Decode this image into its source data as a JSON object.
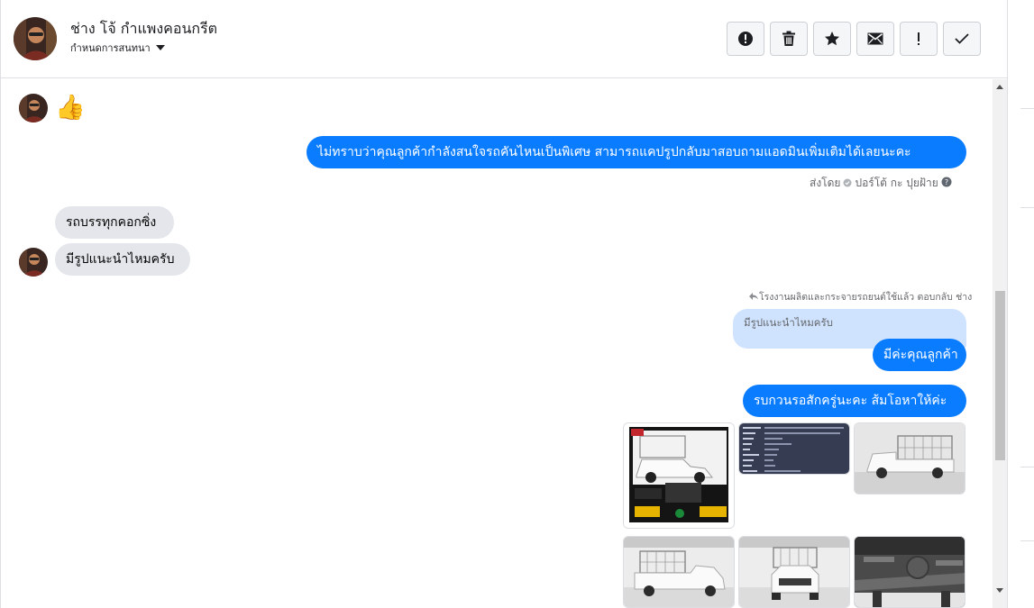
{
  "header": {
    "contact_name": "ช่าง โจ้ กำแพงคอนกรีต",
    "assign_label": "กำหนดการสนทนา",
    "actions": [
      {
        "icon": "alert-circle-icon"
      },
      {
        "icon": "trash-icon"
      },
      {
        "icon": "star-icon"
      },
      {
        "icon": "envelope-icon"
      },
      {
        "icon": "exclamation-icon"
      },
      {
        "icon": "checkmark-icon"
      }
    ]
  },
  "thread": {
    "reaction_emoji": "👍",
    "messages": {
      "outgoing_1": "ไม่ทราบว่าคุณลูกค้ากำลังสนใจรถคันไหนเป็นพิเศษ สามารถแคปรูปกลับมาสอบถามแอดมินเพิ่มเติมได้เลยนะคะ",
      "sent_by_prefix": "ส่งโดย",
      "sent_by_name": "ปอร์โต้ กะ ปุยฝ้าย",
      "incoming_1": "รถบรรทุกคอกซิ่ง",
      "incoming_2": "มีรูปแนะนำไหมครับ",
      "reply_label": "โรงงานผลิตและกระจายรถยนต์ใช้แล้ว ตอบกลับ ช่าง",
      "quoted_text": "มีรูปแนะนำไหมครับ",
      "outgoing_2": "มีค่ะคุณลูกค้า",
      "outgoing_3": "รบกวนรอสักครู่นะคะ ส้มโอหาให้ค่ะ"
    }
  },
  "colors": {
    "outgoing_bubble": "#0a7cff",
    "incoming_bubble": "#e4e6eb",
    "quoted_bubble": "#cfe3ff"
  }
}
